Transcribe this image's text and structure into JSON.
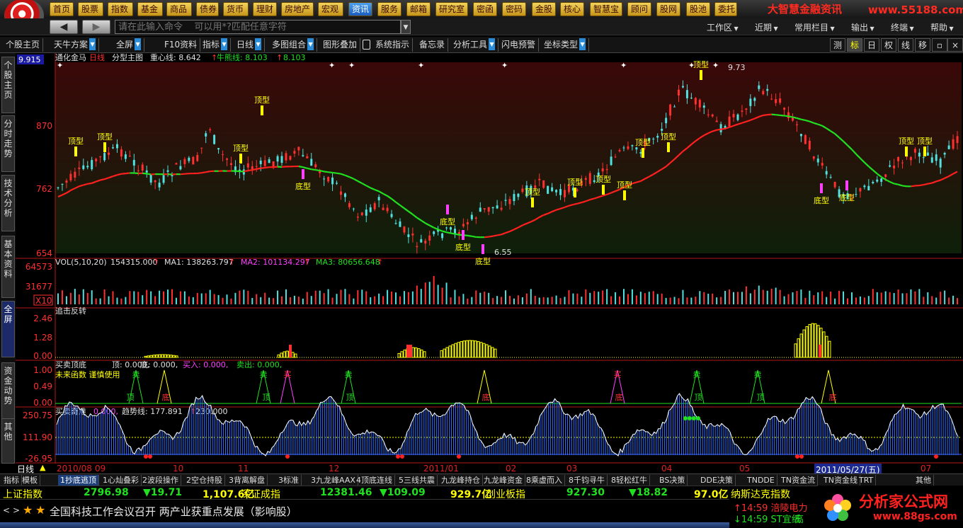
{
  "menu": {
    "items": [
      "首页",
      "股票",
      "指数",
      "基金",
      "商品",
      "债券",
      "货币",
      "理财",
      "房地产",
      "宏观",
      "资讯",
      "服务",
      "邮箱",
      "研究室",
      "密函",
      "密码",
      "金股",
      "核心",
      "智慧宝",
      "顾问",
      "股网",
      "股池",
      "委托"
    ],
    "active": "资讯"
  },
  "brand": {
    "logo": "大智慧金融资讯",
    "url": "www.55188.com"
  },
  "cmdbar": {
    "back": "◀",
    "forward": "▶",
    "placeholder": "请在此输入命令    可以用*?匹配任意字符",
    "right": [
      "工作区",
      "近期",
      "常用栏目",
      "输出",
      "终端",
      "帮助"
    ]
  },
  "toolbar": {
    "items": [
      "个股主页",
      "天牛方案",
      "全屏",
      "F10资料",
      "指标",
      "日线",
      "多图组合",
      "图形叠加",
      "系统指示",
      "备忘录",
      "分析工具",
      "闪电预警",
      "坐标类型"
    ],
    "right": [
      "测",
      "标",
      "日",
      "权",
      "线",
      "移"
    ],
    "active_right": "标"
  },
  "sidetabs": [
    "个股主页",
    "分时走势",
    "技术分析",
    "基本资料",
    "全屏",
    "资金动势",
    "其他"
  ],
  "sidetab_active": "全屏",
  "panels": {
    "main": {
      "stock": "通化金马",
      "period": "日线",
      "tpl": "分型主图",
      "zx": "重心线: 8.642",
      "nl": "牛熊线: 8.103",
      "v3": "8.103",
      "top": "9.915",
      "ticks": [
        "870",
        "762",
        "654"
      ],
      "hi": "9.73",
      "lo": "6.55",
      "mark_top": "顶型",
      "mark_bot": "底型"
    },
    "vol": {
      "title": "VOL(5,10,20)",
      "v": "154315.000",
      "ma1": "MA1: 138263.797",
      "ma2": "MA2: 101134.297",
      "ma3": "MA3: 80656.648",
      "ticks": [
        "64573",
        "31677"
      ],
      "unit": "X10"
    },
    "zj": {
      "title": "追击反转",
      "ticks": [
        "2.46",
        "1.28",
        "0.00"
      ]
    },
    "mm": {
      "title": "买卖顶底",
      "top": "顶: 0.000,",
      "bot": "底: 0.000,",
      "buy": "买入: 0.000,",
      "sell": "卖出: 0.000,",
      "warn": "未来函数 谨慎使用",
      "ticks": [
        "1.00",
        "0.49",
        "0.00"
      ],
      "m_top": "顶",
      "m_bot": "底",
      "m_buy": "买",
      "m_sell": "卖"
    },
    "qz": {
      "title": "买卖奇准",
      "v": "0.000,",
      "trend": "趋势线: 177.891",
      "v2": "230.000",
      "ticks": [
        "250.75",
        "111.90",
        "-26.95"
      ]
    }
  },
  "timeaxis": {
    "period": "日线",
    "labels": [
      "2010/08",
      "09",
      "10",
      "11",
      "12",
      "2011/01",
      "02",
      "03",
      "04",
      "05",
      "2011/05/27(五)",
      "07"
    ]
  },
  "bottomtabs": [
    "指标",
    "模板",
    "1抄底逃顶",
    "1心灿叠彩",
    "2波段操作",
    "2空仓持股",
    "3背离解盘",
    "3标准",
    "3九龙峰AAX",
    "4顶底连线",
    "5三线共震",
    "九龙峰持仓",
    "九龙峰资金",
    "8乘虚而入",
    "8千钧寻牛",
    "8轻松红牛",
    "BS决策",
    "DDE决策",
    "TNDDE",
    "TN资金流",
    "TN资金线",
    "TRT",
    "其他"
  ],
  "bottomtab_active": "1抄底逃顶",
  "indexbar": [
    {
      "name": "上证指数",
      "value": "2796.98",
      "chg": "▼19.71",
      "amt": "1,107.6亿"
    },
    {
      "name": "深证成指",
      "value": "12381.46",
      "chg": "▼109.09",
      "amt": "929.7亿"
    },
    {
      "name": "创业板指",
      "value": "927.30",
      "chg": "▼18.82",
      "amt": "97.0亿"
    },
    {
      "name": "纳斯达克指数",
      "value": "",
      "chg": "",
      "amt": ""
    }
  ],
  "news": {
    "text": "全国科技工作会议召开 两产业获重点发展（影响股）"
  },
  "ticker": [
    {
      "time": "14:59",
      "name": "涪陵电力"
    },
    {
      "time": "14:59",
      "name": "ST宜纸"
    }
  ],
  "ticker_extra": "高",
  "watermark": {
    "name": "分析家公式网",
    "url": "www.88gs.com"
  },
  "colors": {
    "up": "#ff3030",
    "down": "#50e0e0",
    "ma_red": "#ff2020",
    "ma_green": "#20e020",
    "yellow": "#ffff00",
    "magenta": "#ff40ff"
  }
}
